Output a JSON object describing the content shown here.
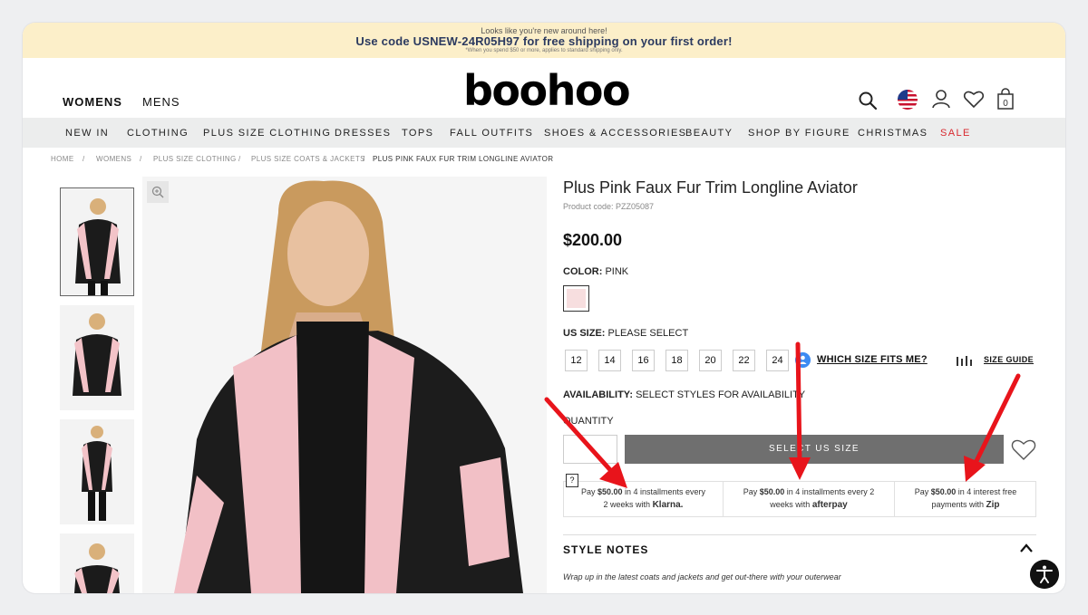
{
  "promo": {
    "line1": "Looks like you're new around here!",
    "line2": "Use code USNEW-24R05H97 for free shipping on your first order!",
    "line3": "*When you spend $50 or more, applies to standard shipping only."
  },
  "header": {
    "womens": "WOMENS",
    "mens": "MENS",
    "logo": "boohoo",
    "bag_count": "0"
  },
  "nav": {
    "items": [
      "NEW IN",
      "CLOTHING",
      "PLUS SIZE CLOTHING",
      "DRESSES",
      "TOPS",
      "FALL OUTFITS",
      "SHOES & ACCESSORIES",
      "BEAUTY",
      "SHOP BY FIGURE",
      "CHRISTMAS",
      "SALE"
    ]
  },
  "breadcrumb": {
    "items": [
      "HOME",
      "/",
      "WOMENS",
      "/",
      "PLUS SIZE CLOTHING",
      "/",
      "PLUS SIZE COATS & JACKETS",
      "/",
      "PLUS PINK FAUX FUR TRIM LONGLINE AVIATOR"
    ]
  },
  "product": {
    "title": "Plus Pink Faux Fur Trim Longline Aviator",
    "code": "Product code: PZZ05087",
    "price": "$200.00",
    "color_label": "COLOR:",
    "color_value": "PINK",
    "swatch_color": "#f7dedf",
    "size_label": "US SIZE:",
    "size_value": "PLEASE SELECT",
    "sizes": [
      "12",
      "14",
      "16",
      "18",
      "20",
      "22",
      "24"
    ],
    "which_size": "WHICH SIZE FITS ME?",
    "size_guide": "SIZE GUIDE",
    "availability_label": "AVAILABILITY:",
    "availability_value": "SELECT STYLES FOR AVAILABILITY",
    "quantity_label": "QUANTITY",
    "add_button": "SELECT US SIZE",
    "button_color": "#6f6f6f"
  },
  "payments": {
    "help": "?",
    "klarna": {
      "amount": "$50.00",
      "text_a": "in 4 installments every",
      "text_b": "2 weeks with",
      "brand": "Klarna."
    },
    "afterpay": {
      "amount": "$50.00",
      "text_a": "in 4 installments every 2",
      "text_b": "weeks with",
      "brand": "afterpay"
    },
    "zip": {
      "amount": "$50.00",
      "text_a": "in 4 interest free",
      "text_b": "payments with",
      "brand": "Zip"
    },
    "pay": "Pay"
  },
  "notes": {
    "heading": "STYLE NOTES",
    "description": "Wrap up in the latest coats and jackets and get out-there with your outerwear"
  },
  "annotation_color": "#e8141b"
}
